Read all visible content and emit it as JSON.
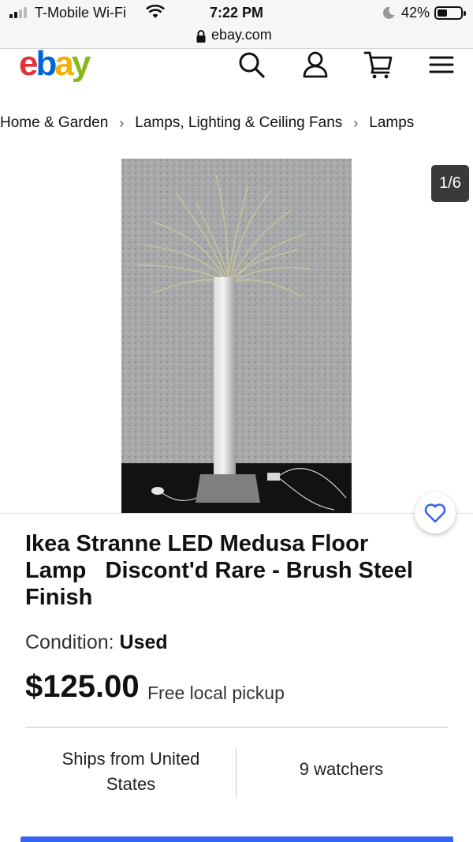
{
  "status_bar": {
    "carrier": "T-Mobile Wi-Fi",
    "time": "7:22 PM",
    "battery_percent_label": "42%",
    "battery_level": 0.42,
    "signal_bars_filled": 2
  },
  "browser": {
    "url": "ebay.com"
  },
  "header": {
    "logo_letters": [
      "e",
      "b",
      "a",
      "y"
    ],
    "icons": [
      "search-icon",
      "account-icon",
      "cart-icon",
      "menu-icon"
    ]
  },
  "breadcrumb": {
    "items": [
      "Home & Garden",
      "Lamps, Lighting & Ceiling Fans",
      "Lamps"
    ],
    "separator": "›"
  },
  "gallery": {
    "counter": "1/6"
  },
  "listing": {
    "title": "Ikea Stranne LED Medusa Floor Lamp   Discont'd Rare - Brush Steel Finish",
    "condition_label": "Condition:",
    "condition_value": "Used",
    "price": "$125.00",
    "shipping": "Free local pickup",
    "ships_from": "Ships from United States",
    "watchers": "9 watchers"
  },
  "colors": {
    "ebay_red": "#e53238",
    "ebay_blue": "#0064d2",
    "ebay_yellow": "#f5af02",
    "ebay_green": "#86b817",
    "accent_blue": "#3665f3"
  }
}
